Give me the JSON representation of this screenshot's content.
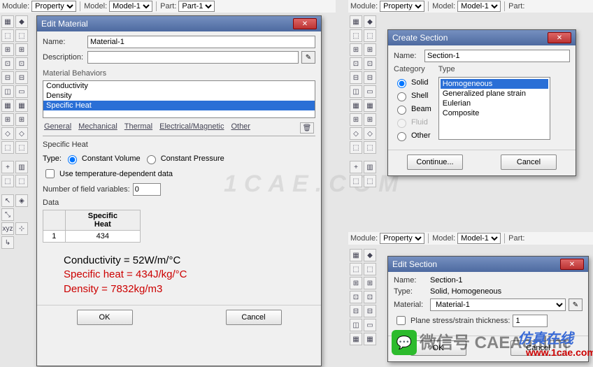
{
  "bar1": {
    "module_lbl": "Module:",
    "module_val": "Property",
    "model_lbl": "Model:",
    "model_val": "Model-1",
    "part_lbl": "Part:",
    "part_val": "Part-1"
  },
  "bar2": {
    "module_lbl": "Module:",
    "module_val": "Property",
    "model_lbl": "Model:",
    "model_val": "Model-1",
    "part_lbl": "Part:"
  },
  "bar3": {
    "module_lbl": "Module:",
    "module_val": "Property",
    "model_lbl": "Model:",
    "model_val": "Model-1",
    "part_lbl": "Part:"
  },
  "edit_material": {
    "title": "Edit Material",
    "name_lbl": "Name:",
    "name_val": "Material-1",
    "desc_lbl": "Description:",
    "behaviors_lbl": "Material Behaviors",
    "behaviors": [
      "Conductivity",
      "Density",
      "Specific Heat"
    ],
    "tabs": [
      "General",
      "Mechanical",
      "Thermal",
      "Electrical/Magnetic",
      "Other"
    ],
    "sh_title": "Specific Heat",
    "type_lbl": "Type:",
    "type_cv": "Constant Volume",
    "type_cp": "Constant Pressure",
    "temp_dep": "Use temperature-dependent data",
    "nfv_lbl": "Number of field variables:",
    "nfv_val": "0",
    "data_lbl": "Data",
    "col_hdr": "Specific\nHeat",
    "row1_idx": "1",
    "row1_val": "434",
    "annot1": "Conductivity = 52W/m/°C",
    "annot2": "Specific heat = 434J/kg/°C",
    "annot3": "Density = 7832kg/m3",
    "ok": "OK",
    "cancel": "Cancel"
  },
  "create_section": {
    "title": "Create Section",
    "name_lbl": "Name:",
    "name_val": "Section-1",
    "cat_lbl": "Category",
    "type_lbl": "Type",
    "cats": [
      "Solid",
      "Shell",
      "Beam",
      "Fluid",
      "Other"
    ],
    "types": [
      "Homogeneous",
      "Generalized plane strain",
      "Eulerian",
      "Composite"
    ],
    "cont": "Continue...",
    "cancel": "Cancel"
  },
  "edit_section": {
    "title": "Edit Section",
    "name_lbl": "Name:",
    "name_val": "Section-1",
    "type_lbl": "Type:",
    "type_val": "Solid, Homogeneous",
    "mat_lbl": "Material:",
    "mat_val": "Material-1",
    "pst_lbl": "Plane stress/strain thickness:",
    "pst_val": "1",
    "ok": "OK",
    "cancel": "Cancel"
  },
  "watermark_main": "1CAE.COM",
  "wm_line1": "微信号 CAEAonline",
  "wm_line2": "仿真在线",
  "wm_line3": "www.1cae.com"
}
